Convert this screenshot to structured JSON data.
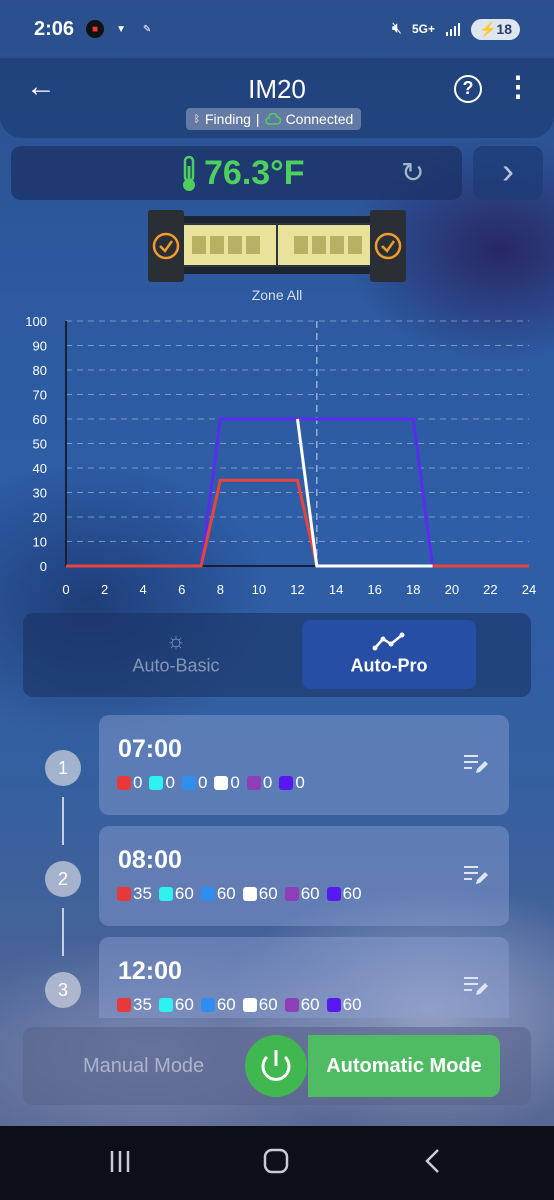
{
  "status": {
    "time": "2:06",
    "network": "5G+",
    "battery": "18"
  },
  "header": {
    "title": "IM20",
    "finding": "Finding",
    "separator": "|",
    "connected": "Connected"
  },
  "temperature": {
    "value": "76.3°F"
  },
  "zone": {
    "label": "Zone All"
  },
  "chart_data": {
    "type": "line",
    "ylim": [
      0,
      100
    ],
    "xlim": [
      0,
      24
    ],
    "y_ticks": [
      "100",
      "90",
      "80",
      "70",
      "60",
      "50",
      "40",
      "30",
      "20",
      "10",
      "0"
    ],
    "x_ticks": [
      "0",
      "2",
      "4",
      "6",
      "8",
      "10",
      "12",
      "14",
      "16",
      "18",
      "20",
      "22",
      "24"
    ],
    "current_time_marker": 13,
    "series": [
      {
        "color": "#5a2cf0",
        "x": [
          0,
          7,
          8,
          18,
          19,
          24
        ],
        "y": [
          0,
          0,
          60,
          60,
          0,
          0
        ]
      },
      {
        "color": "#e8443a",
        "x": [
          0,
          7,
          8,
          12,
          13,
          24
        ],
        "y": [
          0,
          0,
          35,
          35,
          0,
          0
        ]
      },
      {
        "color": "#ffffff",
        "x": [
          12,
          13,
          19
        ],
        "y": [
          60,
          0,
          0
        ]
      }
    ]
  },
  "mode_tabs": {
    "basic": "Auto-Basic",
    "pro": "Auto-Pro"
  },
  "channel_colors": [
    "#e8383a",
    "#2ef2f0",
    "#2f8ff0",
    "#ffffff",
    "#8e3fb8",
    "#5a18f0"
  ],
  "steps": [
    {
      "num": "1",
      "time": "07:00",
      "values": [
        "0",
        "0",
        "0",
        "0",
        "0",
        "0"
      ]
    },
    {
      "num": "2",
      "time": "08:00",
      "values": [
        "35",
        "60",
        "60",
        "60",
        "60",
        "60"
      ]
    },
    {
      "num": "3",
      "time": "12:00",
      "values": [
        "35",
        "60",
        "60",
        "60",
        "60",
        "60"
      ]
    }
  ],
  "bottom": {
    "manual": "Manual Mode",
    "automatic": "Automatic Mode"
  }
}
